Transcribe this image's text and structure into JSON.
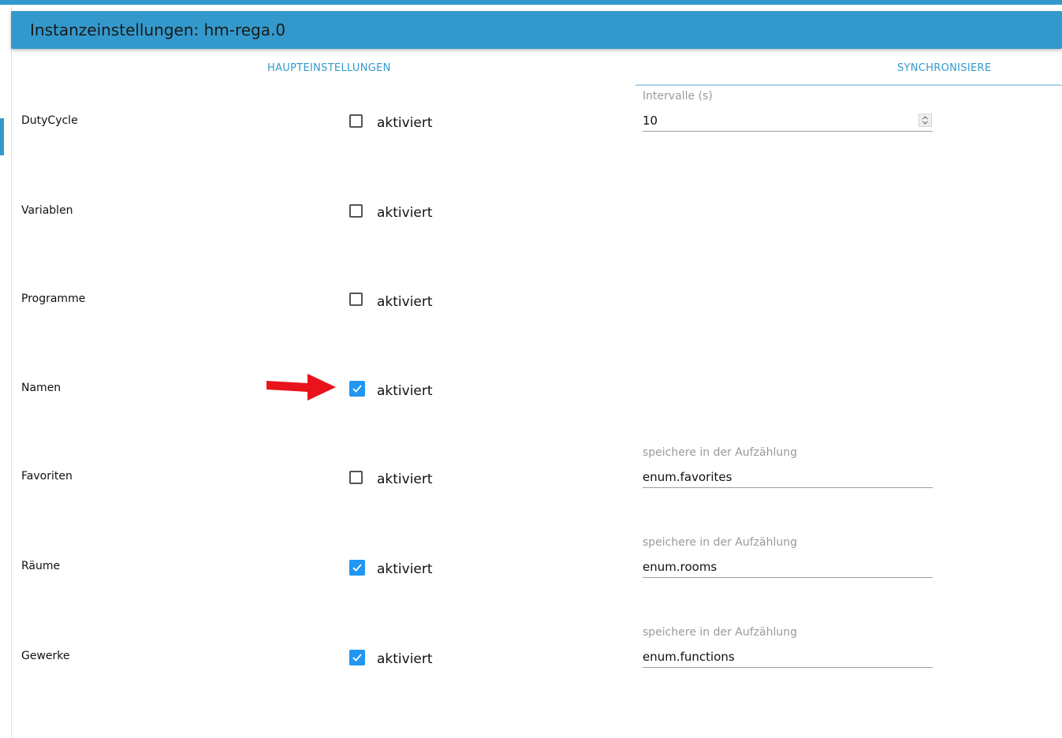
{
  "header": {
    "title": "Instanzeinstellungen: hm-rega.0"
  },
  "tabs": {
    "main": "HAUPTEINSTELLUNGEN",
    "sync": "SYNCHRONISIERE"
  },
  "rows": [
    {
      "label": "DutyCycle",
      "checkbox_label": "aktiviert",
      "checked": false
    },
    {
      "label": "Variablen",
      "checkbox_label": "aktiviert",
      "checked": false
    },
    {
      "label": "Programme",
      "checkbox_label": "aktiviert",
      "checked": false
    },
    {
      "label": "Namen",
      "checkbox_label": "aktiviert",
      "checked": true
    },
    {
      "label": "Favoriten",
      "checkbox_label": "aktiviert",
      "checked": false
    },
    {
      "label": "Räume",
      "checkbox_label": "aktiviert",
      "checked": true
    },
    {
      "label": "Gewerke",
      "checkbox_label": "aktiviert",
      "checked": true
    }
  ],
  "fields": {
    "interval": {
      "label": "Intervalle (s)",
      "value": "10"
    },
    "favorites": {
      "label": "speichere in der Aufzählung",
      "value": "enum.favorites"
    },
    "rooms": {
      "label": "speichere in der Aufzählung",
      "value": "enum.rooms"
    },
    "functions": {
      "label": "speichere in der Aufzählung",
      "value": "enum.functions"
    }
  },
  "colors": {
    "accent": "#3399cc",
    "checkbox": "#2196f3",
    "arrow": "#e8131b"
  }
}
